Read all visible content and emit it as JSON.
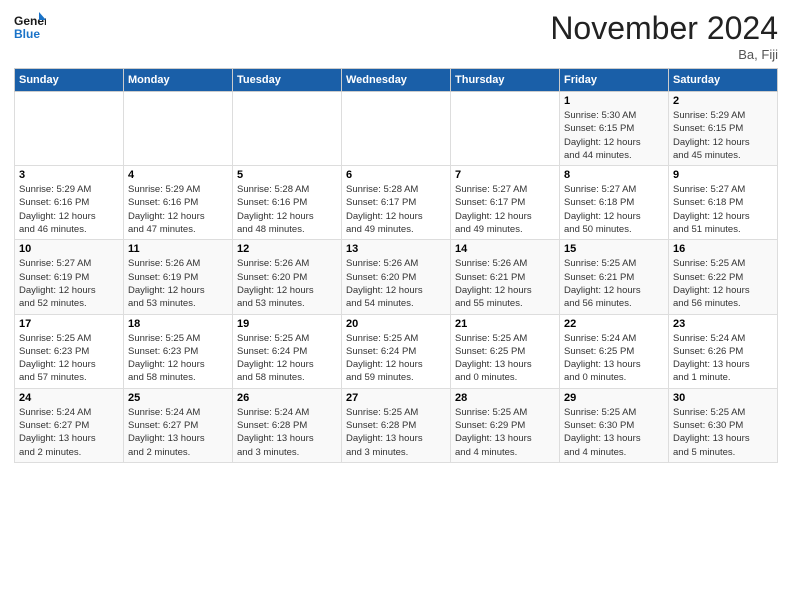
{
  "header": {
    "logo_line1": "General",
    "logo_line2": "Blue",
    "month_title": "November 2024",
    "location": "Ba, Fiji"
  },
  "weekdays": [
    "Sunday",
    "Monday",
    "Tuesday",
    "Wednesday",
    "Thursday",
    "Friday",
    "Saturday"
  ],
  "weeks": [
    [
      {
        "day": "",
        "info": ""
      },
      {
        "day": "",
        "info": ""
      },
      {
        "day": "",
        "info": ""
      },
      {
        "day": "",
        "info": ""
      },
      {
        "day": "",
        "info": ""
      },
      {
        "day": "1",
        "info": "Sunrise: 5:30 AM\nSunset: 6:15 PM\nDaylight: 12 hours\nand 44 minutes."
      },
      {
        "day": "2",
        "info": "Sunrise: 5:29 AM\nSunset: 6:15 PM\nDaylight: 12 hours\nand 45 minutes."
      }
    ],
    [
      {
        "day": "3",
        "info": "Sunrise: 5:29 AM\nSunset: 6:16 PM\nDaylight: 12 hours\nand 46 minutes."
      },
      {
        "day": "4",
        "info": "Sunrise: 5:29 AM\nSunset: 6:16 PM\nDaylight: 12 hours\nand 47 minutes."
      },
      {
        "day": "5",
        "info": "Sunrise: 5:28 AM\nSunset: 6:16 PM\nDaylight: 12 hours\nand 48 minutes."
      },
      {
        "day": "6",
        "info": "Sunrise: 5:28 AM\nSunset: 6:17 PM\nDaylight: 12 hours\nand 49 minutes."
      },
      {
        "day": "7",
        "info": "Sunrise: 5:27 AM\nSunset: 6:17 PM\nDaylight: 12 hours\nand 49 minutes."
      },
      {
        "day": "8",
        "info": "Sunrise: 5:27 AM\nSunset: 6:18 PM\nDaylight: 12 hours\nand 50 minutes."
      },
      {
        "day": "9",
        "info": "Sunrise: 5:27 AM\nSunset: 6:18 PM\nDaylight: 12 hours\nand 51 minutes."
      }
    ],
    [
      {
        "day": "10",
        "info": "Sunrise: 5:27 AM\nSunset: 6:19 PM\nDaylight: 12 hours\nand 52 minutes."
      },
      {
        "day": "11",
        "info": "Sunrise: 5:26 AM\nSunset: 6:19 PM\nDaylight: 12 hours\nand 53 minutes."
      },
      {
        "day": "12",
        "info": "Sunrise: 5:26 AM\nSunset: 6:20 PM\nDaylight: 12 hours\nand 53 minutes."
      },
      {
        "day": "13",
        "info": "Sunrise: 5:26 AM\nSunset: 6:20 PM\nDaylight: 12 hours\nand 54 minutes."
      },
      {
        "day": "14",
        "info": "Sunrise: 5:26 AM\nSunset: 6:21 PM\nDaylight: 12 hours\nand 55 minutes."
      },
      {
        "day": "15",
        "info": "Sunrise: 5:25 AM\nSunset: 6:21 PM\nDaylight: 12 hours\nand 56 minutes."
      },
      {
        "day": "16",
        "info": "Sunrise: 5:25 AM\nSunset: 6:22 PM\nDaylight: 12 hours\nand 56 minutes."
      }
    ],
    [
      {
        "day": "17",
        "info": "Sunrise: 5:25 AM\nSunset: 6:23 PM\nDaylight: 12 hours\nand 57 minutes."
      },
      {
        "day": "18",
        "info": "Sunrise: 5:25 AM\nSunset: 6:23 PM\nDaylight: 12 hours\nand 58 minutes."
      },
      {
        "day": "19",
        "info": "Sunrise: 5:25 AM\nSunset: 6:24 PM\nDaylight: 12 hours\nand 58 minutes."
      },
      {
        "day": "20",
        "info": "Sunrise: 5:25 AM\nSunset: 6:24 PM\nDaylight: 12 hours\nand 59 minutes."
      },
      {
        "day": "21",
        "info": "Sunrise: 5:25 AM\nSunset: 6:25 PM\nDaylight: 13 hours\nand 0 minutes."
      },
      {
        "day": "22",
        "info": "Sunrise: 5:24 AM\nSunset: 6:25 PM\nDaylight: 13 hours\nand 0 minutes."
      },
      {
        "day": "23",
        "info": "Sunrise: 5:24 AM\nSunset: 6:26 PM\nDaylight: 13 hours\nand 1 minute."
      }
    ],
    [
      {
        "day": "24",
        "info": "Sunrise: 5:24 AM\nSunset: 6:27 PM\nDaylight: 13 hours\nand 2 minutes."
      },
      {
        "day": "25",
        "info": "Sunrise: 5:24 AM\nSunset: 6:27 PM\nDaylight: 13 hours\nand 2 minutes."
      },
      {
        "day": "26",
        "info": "Sunrise: 5:24 AM\nSunset: 6:28 PM\nDaylight: 13 hours\nand 3 minutes."
      },
      {
        "day": "27",
        "info": "Sunrise: 5:25 AM\nSunset: 6:28 PM\nDaylight: 13 hours\nand 3 minutes."
      },
      {
        "day": "28",
        "info": "Sunrise: 5:25 AM\nSunset: 6:29 PM\nDaylight: 13 hours\nand 4 minutes."
      },
      {
        "day": "29",
        "info": "Sunrise: 5:25 AM\nSunset: 6:30 PM\nDaylight: 13 hours\nand 4 minutes."
      },
      {
        "day": "30",
        "info": "Sunrise: 5:25 AM\nSunset: 6:30 PM\nDaylight: 13 hours\nand 5 minutes."
      }
    ]
  ]
}
